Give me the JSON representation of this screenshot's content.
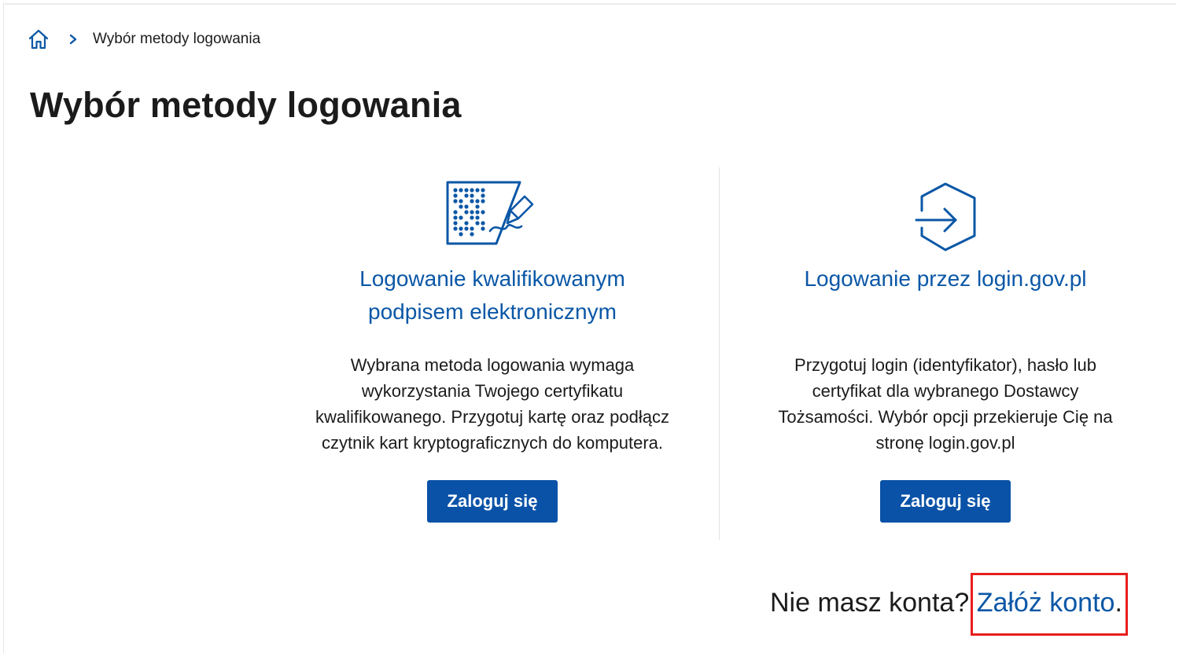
{
  "breadcrumb": {
    "home_icon": "home-icon",
    "separator_icon": "chevron-right-icon",
    "current": "Wybór metody logowania"
  },
  "page": {
    "title": "Wybór metody logowania"
  },
  "options": [
    {
      "icon": "qualified-signature-card-icon",
      "title_line1": "Logowanie kwalifikowanym",
      "title_line2": "podpisem elektronicznym",
      "desc_lines": [
        "Wybrana metoda logowania wymaga",
        "wykorzystania Twojego certyfikatu",
        "kwalifikowanego. Przygotuj kartę oraz podłącz",
        "czytnik kart kryptograficznych do komputera."
      ],
      "button_label": "Zaloguj się"
    },
    {
      "icon": "login-arrow-hexagon-icon",
      "title_line1": "Logowanie przez login.gov.pl",
      "desc_lines": [
        "Przygotuj login (identyfikator), hasło lub",
        "certyfikat dla wybranego Dostawcy",
        "Tożsamości. Wybór opcji przekieruje Cię na",
        "stronę login.gov.pl"
      ],
      "button_label": "Zaloguj się"
    }
  ],
  "register": {
    "prompt": "Nie masz konta?",
    "link_label": "Załóż konto",
    "suffix": "."
  },
  "colors": {
    "brand_blue": "#0a52a7",
    "link_blue": "#0b57a6",
    "highlight_red": "#e81e1e",
    "text": "#1b1b1b"
  }
}
